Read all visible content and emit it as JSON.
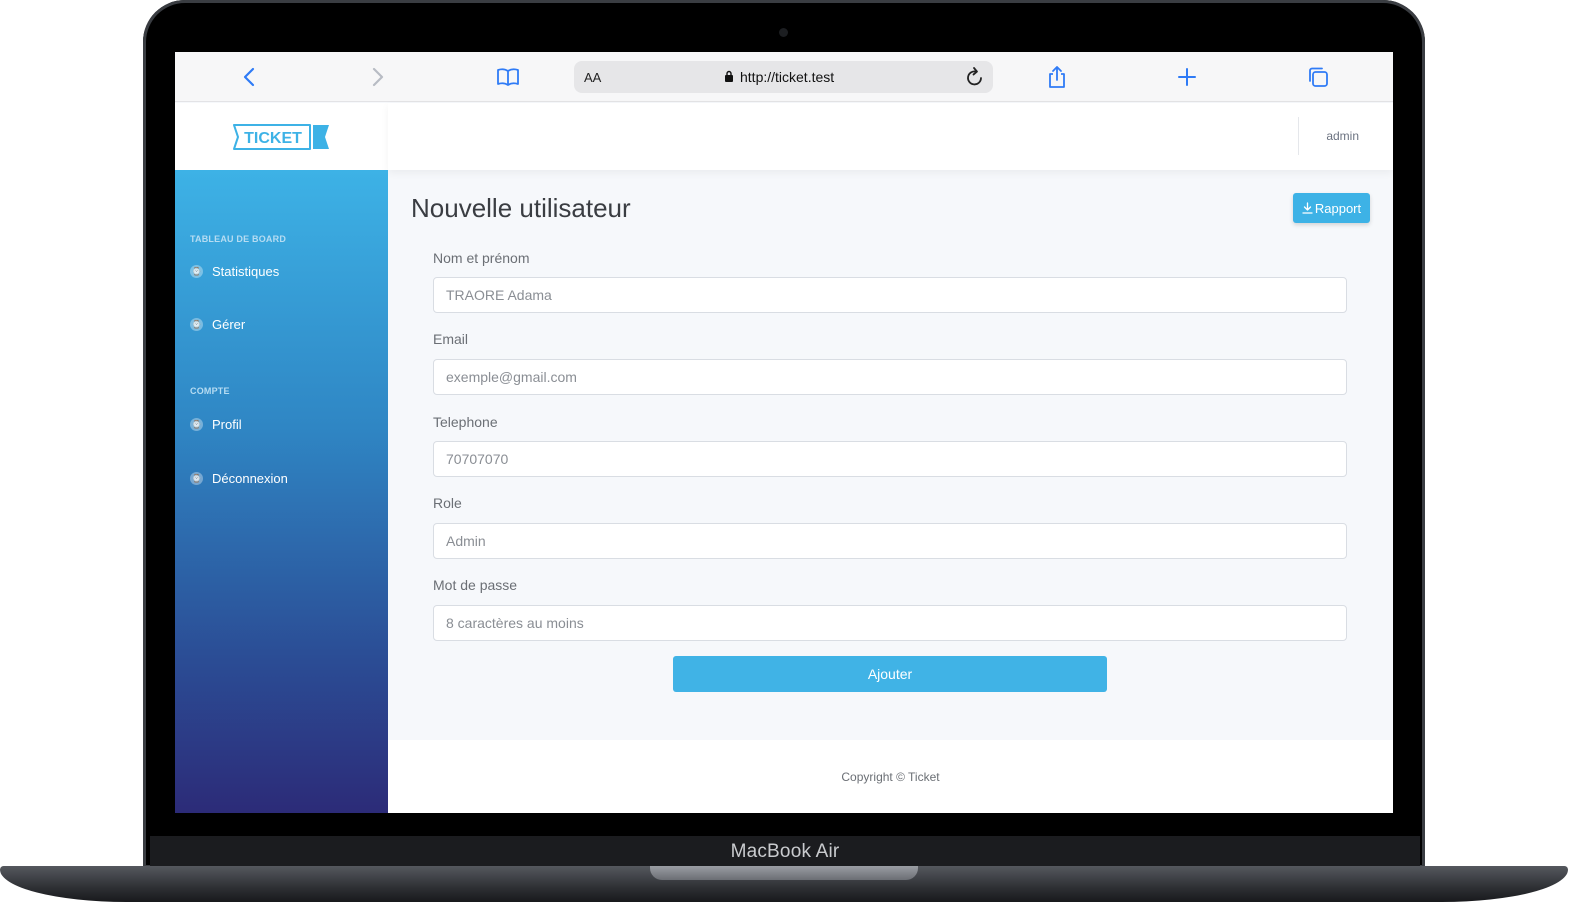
{
  "device": {
    "label": "MacBook Air"
  },
  "browser": {
    "text_size_label": "AA",
    "url": "http://ticket.test"
  },
  "app": {
    "logo_text": "TICKET",
    "user_name": "admin"
  },
  "sidebar": {
    "sections": [
      {
        "heading": "TABLEAU DE BOARD",
        "items": [
          {
            "label": "Statistiques"
          },
          {
            "label": "Gérer"
          }
        ]
      },
      {
        "heading": "COMPTE",
        "items": [
          {
            "label": "Profil"
          },
          {
            "label": "Déconnexion"
          }
        ]
      }
    ]
  },
  "page": {
    "title": "Nouvelle utilisateur",
    "report_button": "Rapport"
  },
  "form": {
    "fields": [
      {
        "label": "Nom et prénom",
        "placeholder": "TRAORE Adama"
      },
      {
        "label": "Email",
        "placeholder": "exemple@gmail.com"
      },
      {
        "label": "Telephone",
        "placeholder": "70707070"
      },
      {
        "label": "Role",
        "placeholder": "Admin"
      },
      {
        "label": "Mot de passe",
        "placeholder": "8 caractères au moins"
      }
    ],
    "submit_label": "Ajouter"
  },
  "footer": {
    "copyright": "Copyright © Ticket"
  },
  "colors": {
    "accent": "#3db2e6",
    "sidebar_top": "#3db2e6",
    "sidebar_bottom": "#2c2b78",
    "browser_icon": "#2f7bf6"
  },
  "icons": {
    "back": "chevron-left-icon",
    "forward": "chevron-right-icon",
    "bookmarks": "book-icon",
    "lock": "lock-icon",
    "reload": "reload-icon",
    "share": "share-icon",
    "new_tab": "plus-icon",
    "tabs": "tabs-icon",
    "download": "download-icon",
    "laravel": "laravel-icon"
  }
}
